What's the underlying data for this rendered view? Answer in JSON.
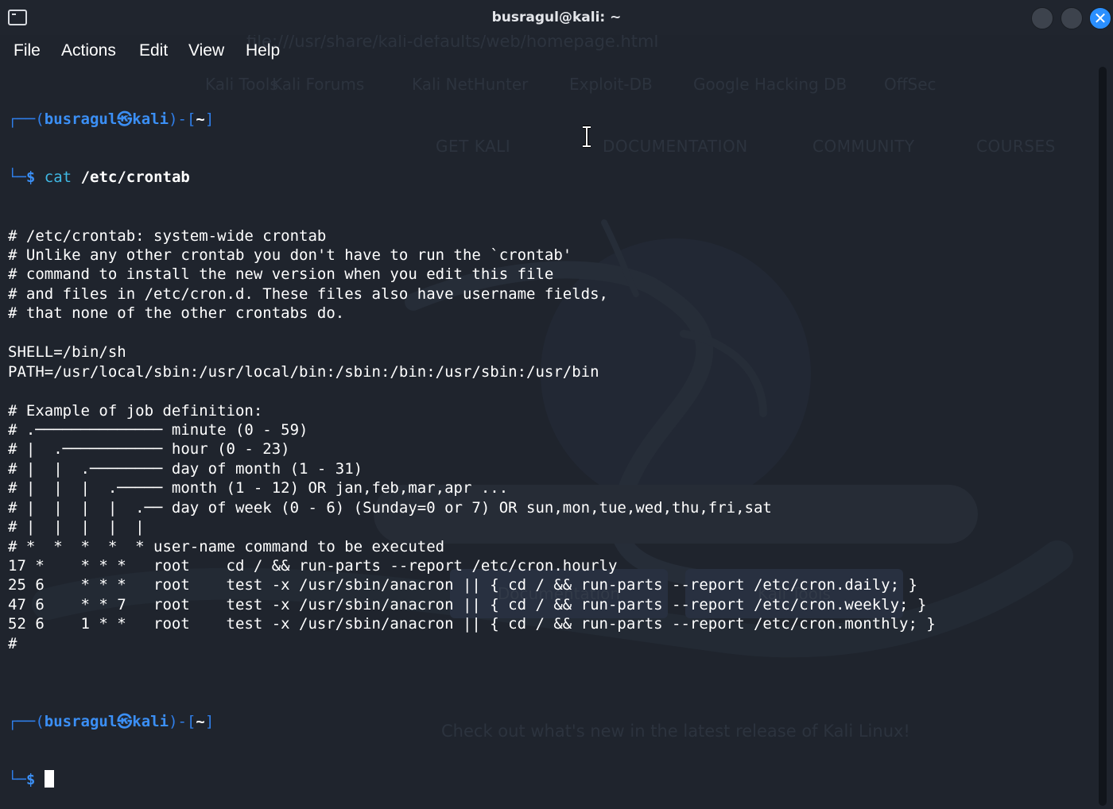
{
  "window": {
    "title": "busragul@kali: ~"
  },
  "menu": [
    "File",
    "Actions",
    "Edit",
    "View",
    "Help"
  ],
  "background": {
    "url": "file:///usr/share/kali-defaults/web/homepage.html",
    "bookmarks": [
      "Kali Tools",
      "Kali Forums",
      "Kali NetHunter",
      "Exploit-DB",
      "Google Hacking DB",
      "OffSec"
    ],
    "nav": [
      "GET KALI",
      "DOCUMENTATION",
      "COMMUNITY",
      "COURSES"
    ],
    "buttons": [
      "Documentation",
      "Kali Tools"
    ],
    "footer": "Check out what's new in the latest release of Kali Linux!"
  },
  "prompt": {
    "user": "busragul",
    "host": "kali",
    "dir": "~",
    "symbol": "$"
  },
  "command": {
    "name": "cat",
    "arg": "/etc/crontab"
  },
  "output": [
    "# /etc/crontab: system-wide crontab",
    "# Unlike any other crontab you don't have to run the `crontab'",
    "# command to install the new version when you edit this file",
    "# and files in /etc/cron.d. These files also have username fields,",
    "# that none of the other crontabs do.",
    "",
    "SHELL=/bin/sh",
    "PATH=/usr/local/sbin:/usr/local/bin:/sbin:/bin:/usr/sbin:/usr/bin",
    "",
    "# Example of job definition:",
    "# .────────────── minute (0 - 59)",
    "# |  .─────────── hour (0 - 23)",
    "# |  |  .──────── day of month (1 - 31)",
    "# |  |  |  .───── month (1 - 12) OR jan,feb,mar,apr ...",
    "# |  |  |  |  .── day of week (0 - 6) (Sunday=0 or 7) OR sun,mon,tue,wed,thu,fri,sat",
    "# |  |  |  |  |",
    "# *  *  *  *  * user-name command to be executed",
    "17 *    * * *   root    cd / && run-parts --report /etc/cron.hourly",
    "25 6    * * *   root    test -x /usr/sbin/anacron || { cd / && run-parts --report /etc/cron.daily; }",
    "47 6    * * 7   root    test -x /usr/sbin/anacron || { cd / && run-parts --report /etc/cron.weekly; }",
    "52 6    1 * *   root    test -x /usr/sbin/anacron || { cd / && run-parts --report /etc/cron.monthly; }",
    "#",
    ""
  ],
  "colors": {
    "background": "#1f242d",
    "prompt_blue": "#2f7ee9",
    "command_cyan": "#3fb8e4",
    "close_button": "#2a8fff"
  }
}
